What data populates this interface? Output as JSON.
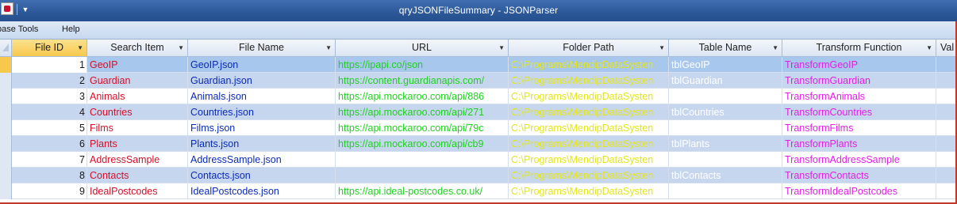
{
  "window": {
    "title": "qryJSONFileSummary  -  JSONParser"
  },
  "menu": {
    "items": [
      "base Tools",
      "Help"
    ]
  },
  "grid": {
    "columns": [
      {
        "label": "File ID"
      },
      {
        "label": "Search Item"
      },
      {
        "label": "File Name"
      },
      {
        "label": "URL"
      },
      {
        "label": "Folder Path"
      },
      {
        "label": "Table Name"
      },
      {
        "label": "Transform Function"
      },
      {
        "label": "Val"
      }
    ],
    "rows": [
      {
        "id": "1",
        "search": "GeoIP",
        "file": "GeoIP.json",
        "url": "https://ipapi.co/json",
        "folder": "C:\\Programs\\MendipDataSysten",
        "table": "tblGeoIP",
        "transform": "TransformGeoIP"
      },
      {
        "id": "2",
        "search": "Guardian",
        "file": "Guardian.json",
        "url": "https://content.guardianapis.com/",
        "folder": "C:\\Programs\\MendipDataSysten",
        "table": "tblGuardian",
        "transform": "TransformGuardian"
      },
      {
        "id": "3",
        "search": "Animals",
        "file": "Animals.json",
        "url": "https://api.mockaroo.com/api/886",
        "folder": "C:\\Programs\\MendipDataSysten",
        "table": "",
        "transform": "TransformAnimals"
      },
      {
        "id": "4",
        "search": "Countries",
        "file": "Countries.json",
        "url": "https://api.mockaroo.com/api/271",
        "folder": "C:\\Programs\\MendipDataSysten",
        "table": "tblCountries",
        "transform": "TransformCountries"
      },
      {
        "id": "5",
        "search": "Films",
        "file": "Films.json",
        "url": "https://api.mockaroo.com/api/79c",
        "folder": "C:\\Programs\\MendipDataSysten",
        "table": "",
        "transform": "TransformFilms"
      },
      {
        "id": "6",
        "search": "Plants",
        "file": "Plants.json",
        "url": "https://api.mockaroo.com/api/cb9",
        "folder": "C:\\Programs\\MendipDataSysten",
        "table": "tblPlants",
        "transform": "TransformPlants"
      },
      {
        "id": "7",
        "search": "AddressSample",
        "file": "AddressSample.json",
        "url": "",
        "folder": "C:\\Programs\\MendipDataSysten",
        "table": "",
        "transform": "TransformAddressSample"
      },
      {
        "id": "8",
        "search": "Contacts",
        "file": "Contacts.json",
        "url": "",
        "folder": "C:\\Programs\\MendipDataSysten",
        "table": "tblContacts",
        "transform": "TransformContacts"
      },
      {
        "id": "9",
        "search": "IdealPostcodes",
        "file": "IdealPostcodes.json",
        "url": "https://api.ideal-postcodes.co.uk/",
        "folder": "C:\\Programs\\MendipDataSysten",
        "table": "",
        "transform": "TransformIdealPostcodes"
      }
    ]
  },
  "colors": {
    "search_item": "#d4102a",
    "file_name": "#0a2ab8",
    "url": "#1fd01f",
    "folder_path": "#e4e619",
    "table_name": "#ffffff",
    "transform_function": "#e41ee4",
    "active_header": "#f6c94d",
    "selected_row": "#a8c7ec",
    "alternate_row": "#c6d6ee"
  },
  "icons": {
    "app": "access-app-icon",
    "qat_dropdown": "chevron-down-icon"
  }
}
